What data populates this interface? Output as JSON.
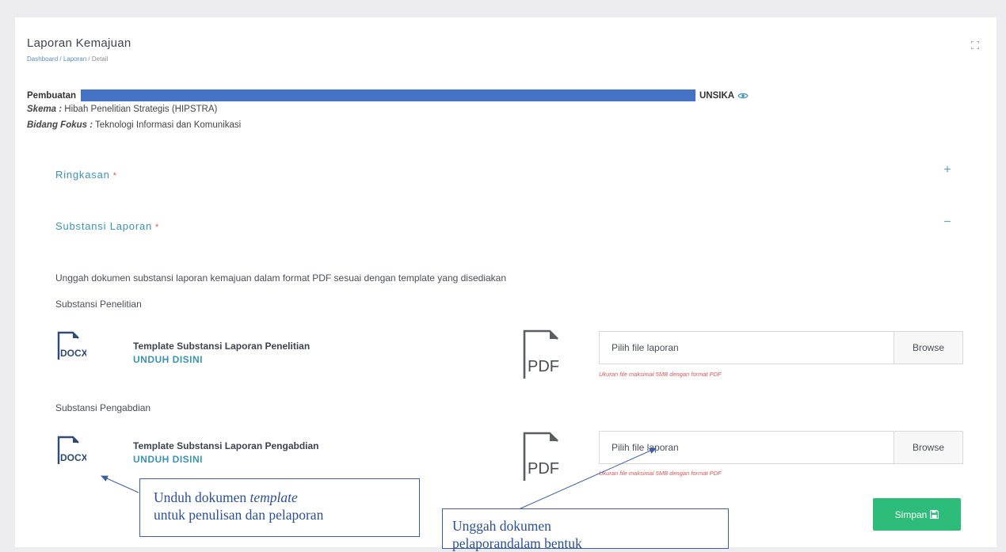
{
  "header": {
    "title": "Laporan Kemajuan",
    "breadcrumb": {
      "dashboard": "Dashboard",
      "sep1": " / ",
      "laporan": "Laporan",
      "sep2": " / ",
      "detail": "Detail"
    }
  },
  "project": {
    "prefix": "Pembuatan",
    "suffix": "UNSIKA",
    "redact_color": "#4472c4",
    "skema_label": "Skema :",
    "skema_value": " Hibah Penelitian Strategis (HIPSTRA)",
    "bidang_label": "Bidang Fokus :",
    "bidang_value": " Teknologi Informasi dan Komunikasi"
  },
  "sections": {
    "ringkasan": {
      "label": "Ringkasan",
      "required": "*",
      "toggle": "+"
    },
    "substansi": {
      "label": "Substansi Laporan",
      "required": "*",
      "toggle": "−"
    }
  },
  "substansi": {
    "note": "Unggah dokumen substansi laporan kemajuan dalam format PDF sesuai dengan template yang disediakan",
    "penelitian": {
      "label": "Substansi Penelitian",
      "doc_icon_text": "DOCX",
      "template_title": "Template Substansi Laporan Penelitian",
      "download_link": "UNDUH DISINI",
      "pdf_icon_text": "PDF",
      "file_placeholder": "Pilih file laporan",
      "browse_label": "Browse",
      "hint": "Ukuran file maksimal 5MB dengan format PDF"
    },
    "pengabdian": {
      "label": "Substansi Pengabdian",
      "doc_icon_text": "DOCX",
      "template_title": "Template Substansi Laporan Pengabdian",
      "download_link": "UNDUH DISINI",
      "pdf_icon_text": "PDF",
      "file_placeholder": "Pilih file laporan",
      "browse_label": "Browse",
      "hint": "Ukuran file maksimal 5MB dengan format PDF"
    }
  },
  "actions": {
    "save_label": "Simpan",
    "save_color": "#2ebc7a"
  },
  "annotations": {
    "left_line1_a": "Unduh dokumen ",
    "left_line1_b": "template",
    "left_line2": "untuk penulisan dan pelaporan",
    "right_line1": "Unggah dokumen",
    "right_line2": "pelaporandalam bentuk",
    "color": "#2a4fa0"
  },
  "icons": [
    "expand-icon",
    "eye-icon",
    "docx-file-icon",
    "pdf-file-icon",
    "save-icon"
  ]
}
